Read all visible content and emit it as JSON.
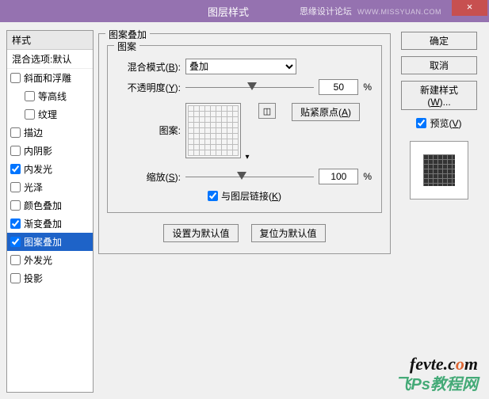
{
  "titlebar": {
    "title": "图层样式",
    "branding": "思缘设计论坛",
    "branding_url": "WWW.MISSYUAN.COM",
    "close": "×"
  },
  "left": {
    "header": "样式",
    "blend_defaults": "混合选项:默认",
    "items": [
      {
        "label": "斜面和浮雕",
        "checked": false
      },
      {
        "label": "等高线",
        "checked": false,
        "indent": true
      },
      {
        "label": "纹理",
        "checked": false,
        "indent": true
      },
      {
        "label": "描边",
        "checked": false
      },
      {
        "label": "内阴影",
        "checked": false
      },
      {
        "label": "内发光",
        "checked": true
      },
      {
        "label": "光泽",
        "checked": false
      },
      {
        "label": "颜色叠加",
        "checked": false
      },
      {
        "label": "渐变叠加",
        "checked": true
      },
      {
        "label": "图案叠加",
        "checked": true,
        "selected": true
      },
      {
        "label": "外发光",
        "checked": false
      },
      {
        "label": "投影",
        "checked": false
      }
    ]
  },
  "center": {
    "group_title": "图案叠加",
    "pattern_group": "图案",
    "blend_mode_label": "混合模式(B):",
    "blend_mode_value": "叠加",
    "opacity_label": "不透明度(Y):",
    "opacity_value": "50",
    "percent": "%",
    "pattern_label": "图案:",
    "snap_origin_btn": "贴紧原点(A)",
    "scale_label": "缩放(S):",
    "scale_value": "100",
    "link_with_layer": "与图层链接(K)",
    "set_default": "设置为默认值",
    "reset_default": "复位为默认值"
  },
  "right": {
    "ok": "确定",
    "cancel": "取消",
    "new_style": "新建样式(W)...",
    "preview": "预览(V)"
  },
  "watermark": {
    "line1a": "fevte.c",
    "line1b": "o",
    "line1c": "m",
    "line2": "飞Ps教程网"
  }
}
